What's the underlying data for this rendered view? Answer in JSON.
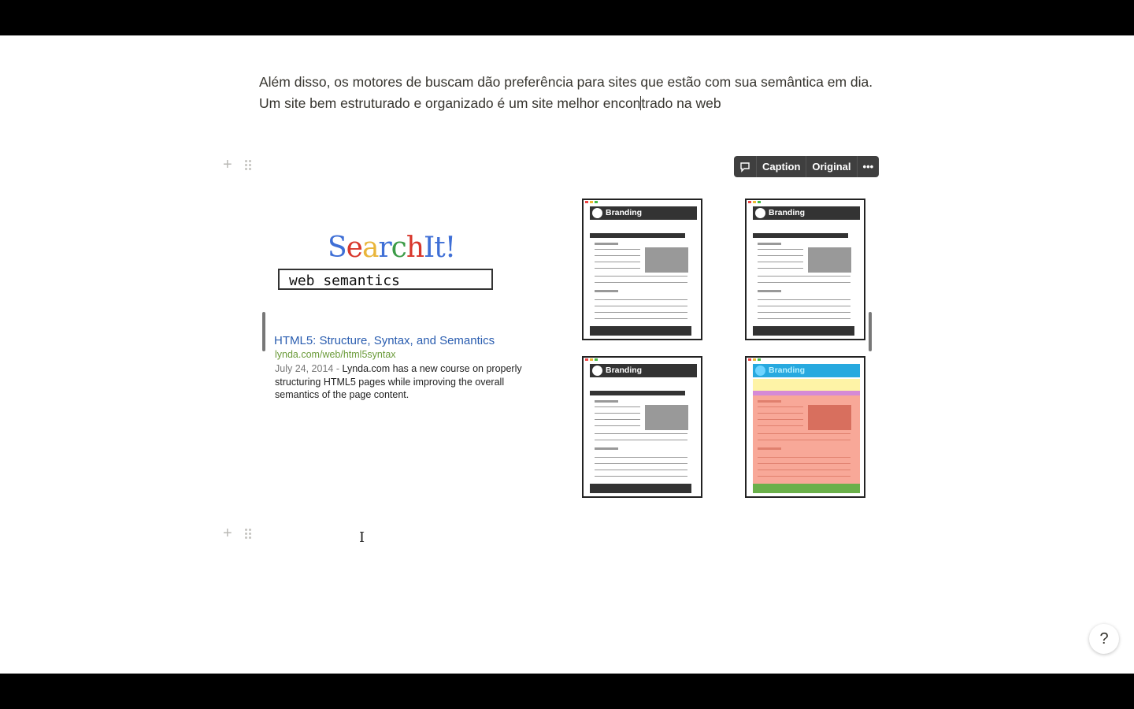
{
  "document": {
    "paragraph_before_caret": "Além disso, os motores de buscam dão preferência para sites que estão com sua semântica em dia. Um site bem estruturado e organizado é um site melhor encon",
    "paragraph_after_caret": "trado na web"
  },
  "image_toolbar": {
    "comment_icon": "comment-icon",
    "caption_label": "Caption",
    "original_label": "Original",
    "more_label": "•••"
  },
  "block_controls": {
    "add_symbol": "+"
  },
  "embedded_image": {
    "logo_letters": [
      {
        "ch": "S",
        "color": "#3f6fd6"
      },
      {
        "ch": "e",
        "color": "#d8372c"
      },
      {
        "ch": "a",
        "color": "#e9b53a"
      },
      {
        "ch": "r",
        "color": "#3f6fd6"
      },
      {
        "ch": "c",
        "color": "#3b9b46"
      },
      {
        "ch": "h",
        "color": "#d8372c"
      },
      {
        "ch": "I",
        "color": "#3f6fd6"
      },
      {
        "ch": "t",
        "color": "#3f6fd6"
      },
      {
        "ch": "!",
        "color": "#3f6fd6"
      }
    ],
    "search_query": "web semantics",
    "result": {
      "title": "HTML5: Structure, Syntax, and Semantics",
      "url": "lynda.com/web/html5syntax",
      "date": "July 24, 2014 -",
      "snippet": "Lynda.com has a new course on properly structuring HTML5 pages while improving the overall semantics of the page content."
    },
    "mockup_brand_label": "Branding"
  },
  "help_button": {
    "label": "?"
  }
}
